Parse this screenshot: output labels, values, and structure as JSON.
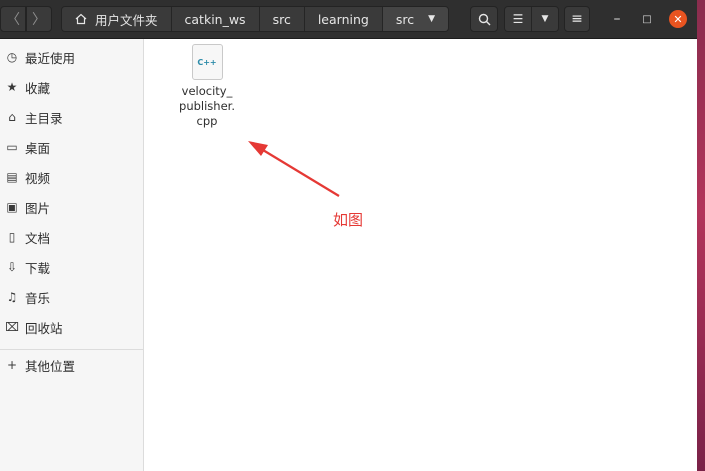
{
  "header": {
    "back_glyph": "〈",
    "forward_glyph": "〉",
    "breadcrumbs": [
      "用户文件夹",
      "catkin_ws",
      "src",
      "learning",
      "src"
    ],
    "dropdown_glyph": "▼",
    "search_glyph": "⌕",
    "list_view_glyph": "☰",
    "menu_glyph": "≡",
    "minimize_glyph": "–",
    "maximize_glyph": "□",
    "close_glyph": "✕"
  },
  "sidebar": {
    "items": [
      {
        "label": "最近使用",
        "icon": "clock-icon",
        "glyph": "◷"
      },
      {
        "label": "收藏",
        "icon": "star-icon",
        "glyph": "★"
      },
      {
        "label": "主目录",
        "icon": "home-icon",
        "glyph": "⌂"
      },
      {
        "label": "桌面",
        "icon": "desktop-icon",
        "glyph": "▭"
      },
      {
        "label": "视频",
        "icon": "video-icon",
        "glyph": "▤"
      },
      {
        "label": "图片",
        "icon": "picture-icon",
        "glyph": "▣"
      },
      {
        "label": "文档",
        "icon": "document-icon",
        "glyph": "▯"
      },
      {
        "label": "下载",
        "icon": "download-icon",
        "glyph": "⇩"
      },
      {
        "label": "音乐",
        "icon": "music-icon",
        "glyph": "♫"
      },
      {
        "label": "回收站",
        "icon": "trash-icon",
        "glyph": "⌧"
      }
    ],
    "other": {
      "label": "其他位置",
      "icon": "plus-icon",
      "glyph": "+"
    }
  },
  "content": {
    "file": {
      "icon_text": "C++",
      "name_lines": [
        "velocity_",
        "publisher.",
        "cpp"
      ]
    },
    "annotation": {
      "text": "如图",
      "color": "#e53935"
    }
  },
  "colors": {
    "headerbar": "#2f2f2f",
    "close_button": "#e95420",
    "sidebar": "#f6f6f6"
  }
}
